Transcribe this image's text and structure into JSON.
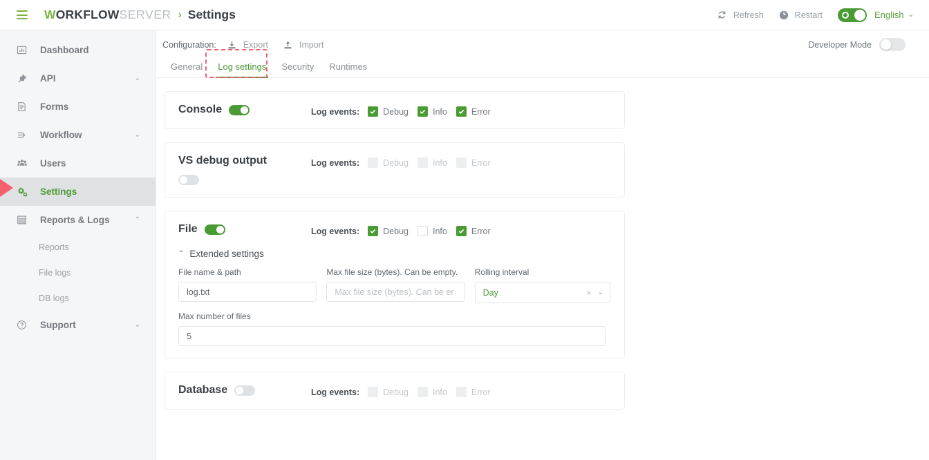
{
  "header": {
    "menu_icon": "hamburger-icon",
    "brand": {
      "w": "W",
      "orkflow": "ORKFLOW",
      "server": "SERVER"
    },
    "breadcrumb_separator": "›",
    "page_title": "Settings",
    "refresh_label": "Refresh",
    "restart_label": "Restart",
    "language_label": "English",
    "language_caret": "⌄",
    "language_toggle_on": true,
    "accent_green": "#4b9b35",
    "logo_green": "#7cb342"
  },
  "sidebar": {
    "items": [
      {
        "label": "Dashboard",
        "icon": "dashboard-icon",
        "expandable": false,
        "active": false
      },
      {
        "label": "API",
        "icon": "api-plug-icon",
        "expandable": true,
        "caret": "⌄",
        "active": false
      },
      {
        "label": "Forms",
        "icon": "forms-icon",
        "expandable": false,
        "active": false
      },
      {
        "label": "Workflow",
        "icon": "workflow-icon",
        "expandable": true,
        "caret": "⌄",
        "active": false
      },
      {
        "label": "Users",
        "icon": "users-icon",
        "expandable": false,
        "active": false
      },
      {
        "label": "Settings",
        "icon": "gears-icon",
        "expandable": false,
        "active": true
      },
      {
        "label": "Reports & Logs",
        "icon": "reports-icon",
        "expandable": true,
        "caret": "⌃",
        "active": false
      }
    ],
    "sub_items": [
      {
        "label": "Reports"
      },
      {
        "label": "File logs"
      },
      {
        "label": "DB logs"
      }
    ],
    "support": {
      "label": "Support",
      "icon": "question-circle-icon",
      "caret": "⌄"
    }
  },
  "main": {
    "config": {
      "label": "Configuration:",
      "export_label": "Export",
      "export_icon": "download-icon",
      "import_label": "Import",
      "import_icon": "upload-icon"
    },
    "developer_mode": {
      "label": "Developer Mode",
      "enabled": false
    },
    "tabs": [
      {
        "label": "General",
        "active": false
      },
      {
        "label": "Log settings",
        "active": true,
        "highlighted": true
      },
      {
        "label": "Security",
        "active": false
      },
      {
        "label": "Runtimes",
        "active": false
      }
    ],
    "log_events_label": "Log events:",
    "cards": [
      {
        "title": "Console",
        "enabled": true,
        "title_wrapped": false,
        "events": [
          {
            "label": "Debug",
            "state": "checked"
          },
          {
            "label": "Info",
            "state": "checked"
          },
          {
            "label": "Error",
            "state": "checked"
          }
        ]
      },
      {
        "title": "VS debug output",
        "enabled": false,
        "title_wrapped": true,
        "events": [
          {
            "label": "Debug",
            "state": "disabled"
          },
          {
            "label": "Info",
            "state": "disabled"
          },
          {
            "label": "Error",
            "state": "disabled"
          }
        ]
      },
      {
        "title": "File",
        "enabled": true,
        "title_wrapped": false,
        "events": [
          {
            "label": "Debug",
            "state": "checked"
          },
          {
            "label": "Info",
            "state": "unchecked"
          },
          {
            "label": "Error",
            "state": "checked"
          }
        ],
        "extended": {
          "label": "Extended settings",
          "caret": "⌃",
          "expanded": true,
          "file_name": {
            "label": "File name & path",
            "value": "log.txt"
          },
          "max_file_size": {
            "label": "Max file size (bytes). Can be empty.",
            "value": "",
            "placeholder": "Max file size (bytes). Can be er"
          },
          "rolling_interval": {
            "label": "Rolling interval",
            "value": "Day",
            "clear_icon": "×",
            "caret": "⌄"
          },
          "max_files": {
            "label": "Max number of files",
            "value": "5"
          }
        }
      },
      {
        "title": "Database",
        "enabled": false,
        "title_wrapped": false,
        "events": [
          {
            "label": "Debug",
            "state": "disabled"
          },
          {
            "label": "Info",
            "state": "disabled"
          },
          {
            "label": "Error",
            "state": "disabled"
          }
        ]
      }
    ]
  }
}
